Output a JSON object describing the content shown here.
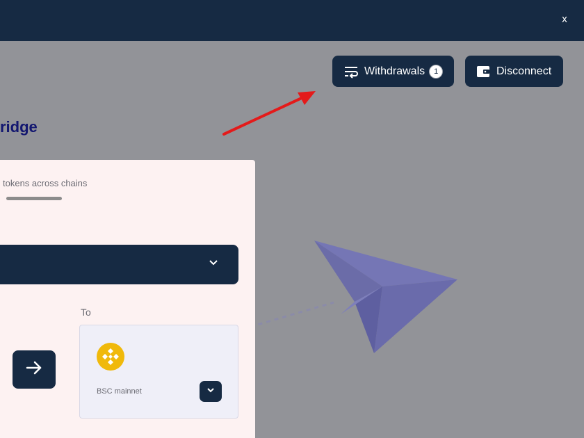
{
  "header": {
    "close_label": "x",
    "withdrawals_label": "Withdrawals",
    "withdrawals_count": "1",
    "disconnect_label": "Disconnect"
  },
  "page": {
    "title": "ridge"
  },
  "card": {
    "subtitle": "tokens across chains",
    "to_label": "To",
    "destination_chain": "BSC mainnet"
  },
  "icons": {
    "withdrawals": "list-swap-icon",
    "disconnect": "wallet-icon",
    "select": "chevron-down-icon",
    "swap": "arrow-right-icon",
    "chain": "bnb-logo-icon",
    "chain_dropdown": "chevron-down-icon"
  },
  "colors": {
    "navy": "#162a43",
    "overlay": "#929398",
    "title": "#131770",
    "bnb": "#f0b90b",
    "annotation_arrow": "#e41a1a",
    "plane": "#7576b5"
  }
}
